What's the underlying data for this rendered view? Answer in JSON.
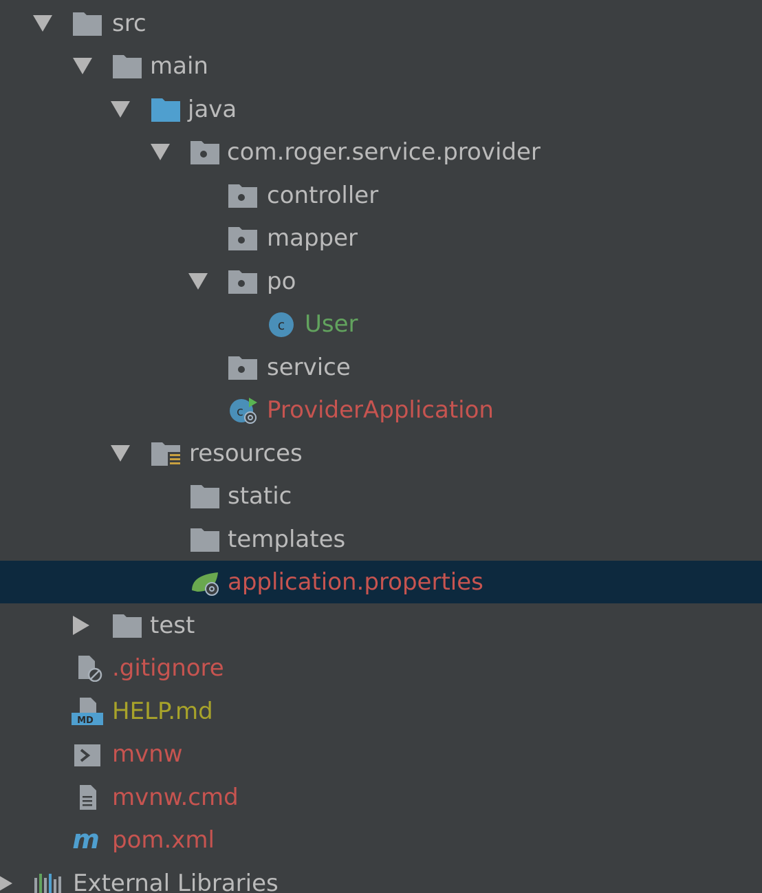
{
  "app": {
    "panel": "Project tree"
  },
  "colors": {
    "background": "#3c3f41",
    "selected_row": "#0d293e",
    "default_text": "#bbbbbb",
    "class_text": "#62a35e",
    "unversioned_text": "#c75450",
    "modified_text": "#a8a32a",
    "folder_gray": "#9aa0a6",
    "source_folder_blue": "#4f9fcf"
  },
  "tree": {
    "src": {
      "label": "src",
      "icon": "folder-icon",
      "expanded": true
    },
    "main": {
      "label": "main",
      "icon": "folder-icon",
      "expanded": true
    },
    "java": {
      "label": "java",
      "icon": "source-folder-icon",
      "expanded": true
    },
    "package": {
      "label": "com.roger.service.provider",
      "icon": "package-icon",
      "expanded": true
    },
    "controller": {
      "label": "controller",
      "icon": "package-icon"
    },
    "mapper": {
      "label": "mapper",
      "icon": "package-icon"
    },
    "po": {
      "label": "po",
      "icon": "package-icon",
      "expanded": true
    },
    "user": {
      "label": "User",
      "icon": "java-class-icon"
    },
    "service": {
      "label": "service",
      "icon": "package-icon"
    },
    "provider_app": {
      "label": "ProviderApplication",
      "icon": "spring-boot-class-icon"
    },
    "resources": {
      "label": "resources",
      "icon": "resources-folder-icon",
      "expanded": true
    },
    "static": {
      "label": "static",
      "icon": "folder-icon"
    },
    "templates": {
      "label": "templates",
      "icon": "folder-icon"
    },
    "app_props": {
      "label": "application.properties",
      "icon": "spring-properties-icon",
      "selected": true
    },
    "test": {
      "label": "test",
      "icon": "folder-icon",
      "expanded": false
    },
    "gitignore": {
      "label": ".gitignore",
      "icon": "ignore-file-icon"
    },
    "help": {
      "label": "HELP.md",
      "icon": "markdown-icon"
    },
    "mvnw": {
      "label": "mvnw",
      "icon": "shell-script-icon"
    },
    "mvnw_cmd": {
      "label": "mvnw.cmd",
      "icon": "text-file-icon"
    },
    "pom": {
      "label": "pom.xml",
      "icon": "maven-icon"
    },
    "external": {
      "label": "External Libraries",
      "icon": "libraries-icon",
      "expanded": false
    }
  }
}
